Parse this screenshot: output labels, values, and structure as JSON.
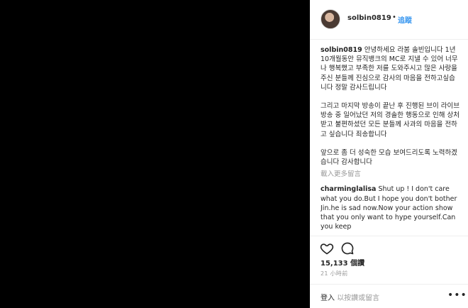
{
  "post": {
    "username": "solbin0819",
    "follow_label": "追蹤",
    "separator": "•"
  },
  "caption": {
    "username": "solbin0819",
    "paragraphs": [
      "안녕하세요 라붐 솔빈입니다 1년 10개월동안 뮤직뱅크의 MC로 지낼 수 있어 너무나 행복했고 부족한 저를 도와주시고 많은 사랑을 주신 분들께 진심으로 감사의 마음을 전하고싶습니다 정말 감사드립니다",
      "그리고 마지막 방송이 끝난 후 진행된 브이 라이브 방송 중 일어났던 저의 경솔한 행동으로 인해 상처받고 불편하셨던 모든 분들께 사과의 마음을 전하고 싶습니다 죄송합니다",
      "앞으로 좀 더 성숙한 모습 보여드리도록 노력하겠습니다 감사합니다"
    ]
  },
  "load_more_label": "載入更多留言",
  "comments": [
    {
      "username": "charminglalisa",
      "text": "Shut up ! I don't care what you do.But I hope you don't bother Jin.he is sad now.Now your action show that you only want to hype yourself.Can you keep"
    }
  ],
  "actions": {
    "like_icon": "heart-outline-icon",
    "comment_icon": "speech-bubble-icon"
  },
  "stats": {
    "views": "15,133 個讚",
    "time_ago": "21 小時前"
  },
  "footer": {
    "login_label": "登入",
    "prompt": "以按讚或留言",
    "more_label": "•••"
  },
  "colors": {
    "media_bg": "#000000",
    "link_blue": "#3897f0",
    "muted": "#999999",
    "text": "#262626",
    "divider": "#efefef"
  }
}
